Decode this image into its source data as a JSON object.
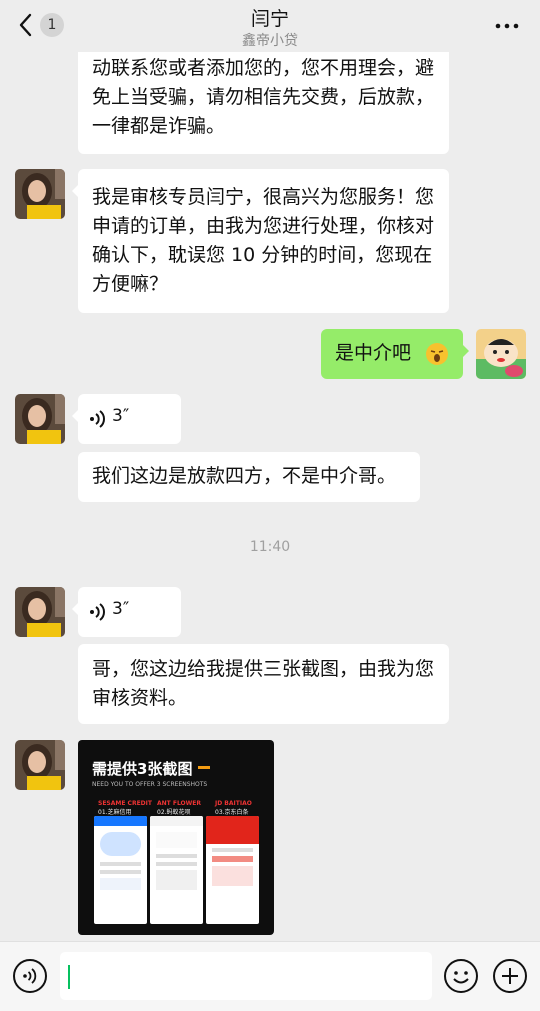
{
  "header": {
    "unread_count": "1",
    "title": "闫宁",
    "subtitle": "鑫帝小贷"
  },
  "messages": {
    "m1": "动联系您或者添加您的，您不用理会，避免上当受骗，请勿相信先交费，后放款，一律都是诈骗。",
    "m2": "我是审核专员闫宁，很高兴为您服务！您申请的订单，由我为您进行处理，你核对确认下，耽误您 10 分钟的时间，您现在方便嘛？",
    "m3_self": "是中介吧",
    "voice1_duration": "3″",
    "m4": "我们这边是放款四方，不是中介哥。",
    "timestamp": "11:40",
    "voice2_duration": "3″",
    "m5": "哥，您这边给我提供三张截图，由我为您审核资料。"
  },
  "image_message": {
    "title": "需提供3张截图",
    "subtitle": "NEED YOU TO OFFER 3 SCREENSHOTS",
    "labels": [
      {
        "en": "SESAME CREDIT",
        "cn": "01.芝麻信用"
      },
      {
        "en": "ANT FLOWER",
        "cn": "02.蚂蚁花呗"
      },
      {
        "en": "JD BAITIAO",
        "cn": "03.京东白条"
      }
    ]
  },
  "colors": {
    "background": "#ededed",
    "self_bubble": "#95ec69",
    "other_bubble": "#ffffff",
    "accent": "#07c160"
  }
}
